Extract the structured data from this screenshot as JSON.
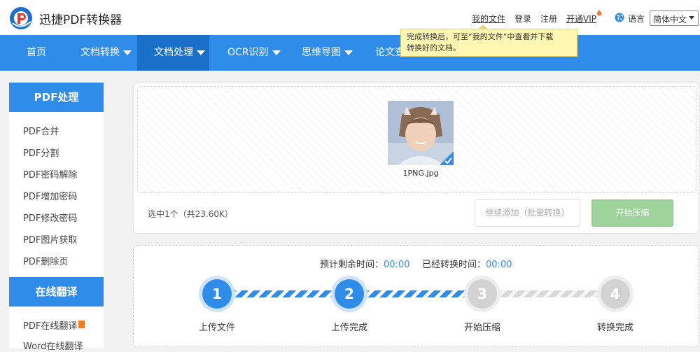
{
  "app": {
    "title": "迅捷PDF转换器"
  },
  "top_links": {
    "my_files": "我的文件",
    "login": "登录",
    "register": "注册",
    "vip": "开通VIP",
    "language_label": "语言",
    "language_value": "简体中文"
  },
  "nav": {
    "items": [
      {
        "label": "首页"
      },
      {
        "label": "文档转换"
      },
      {
        "label": "文档处理"
      },
      {
        "label": "OCR识别"
      },
      {
        "label": "思维导图"
      },
      {
        "label": "论文查"
      }
    ]
  },
  "tooltip": {
    "line1": "完成转换后，可至“我的文件”中查看并下载",
    "line2": "转换好的文档。"
  },
  "sidebar": {
    "section1_title": "PDF处理",
    "items": [
      "PDF合并",
      "PDF分割",
      "PDF密码解除",
      "PDF增加密码",
      "PDF修改密码",
      "PDF图片获取",
      "PDF删除页"
    ],
    "section2_title": "在线翻译",
    "items2": [
      "PDF在线翻译",
      "Word在线翻译"
    ]
  },
  "upload": {
    "file_name": "1PNG.jpg",
    "selected_info": "选中1个（共23.60K）",
    "add_button": "继续添加（批量转换）",
    "start_button": "开始压缩"
  },
  "progress": {
    "remaining_label": "预计剩余时间：",
    "remaining_value": "00:00",
    "elapsed_label": "已经转换时间：",
    "elapsed_value": "00:00",
    "steps": [
      {
        "num": "1",
        "label": "上传文件",
        "done": true
      },
      {
        "num": "2",
        "label": "上传完成",
        "done": true
      },
      {
        "num": "3",
        "label": "开始压缩",
        "done": false
      },
      {
        "num": "4",
        "label": "转换完成",
        "done": false
      }
    ]
  },
  "colors": {
    "accent": "#2f8ce8",
    "nav_active": "#1a6fc9",
    "start_button": "#9dd29b",
    "tooltip_bg": "#fff8b3"
  }
}
